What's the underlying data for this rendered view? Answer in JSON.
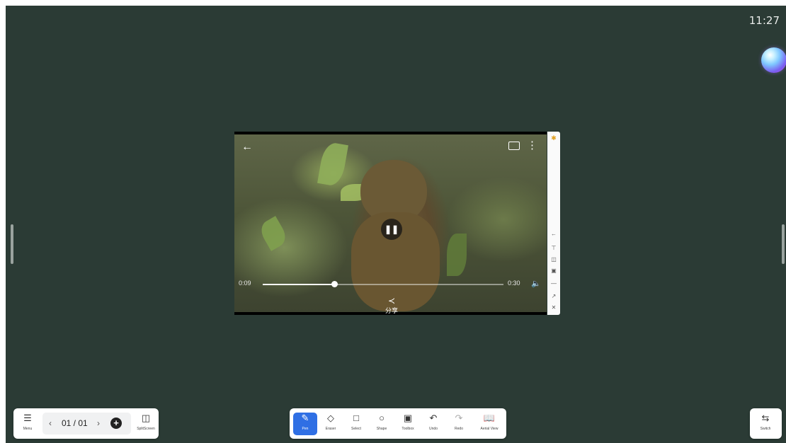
{
  "status_bar": {
    "time": "11:27"
  },
  "video": {
    "current_time": "0:09",
    "total_time": "0:30",
    "progress": 0.3,
    "share_label": "分享"
  },
  "left_bar": {
    "menu_label": "Menu",
    "page_indicator": "01 / 01",
    "split_label": "SplitScreen"
  },
  "tools": [
    {
      "label": "Pen",
      "icon": "pen-icon",
      "active": true
    },
    {
      "label": "Eraser",
      "icon": "eraser-icon"
    },
    {
      "label": "Select",
      "icon": "select-icon"
    },
    {
      "label": "Shape",
      "icon": "shape-icon"
    },
    {
      "label": "Toolbox",
      "icon": "toolbox-icon"
    },
    {
      "label": "Undo",
      "icon": "undo-icon"
    },
    {
      "label": "Redo",
      "icon": "redo-icon"
    },
    {
      "label": "Aerial View",
      "icon": "aerial-view-icon"
    }
  ],
  "right_bar": {
    "switch_label": "Switch"
  },
  "colors": {
    "canvas": "#2b3b35",
    "accent": "#2f6fe4"
  }
}
